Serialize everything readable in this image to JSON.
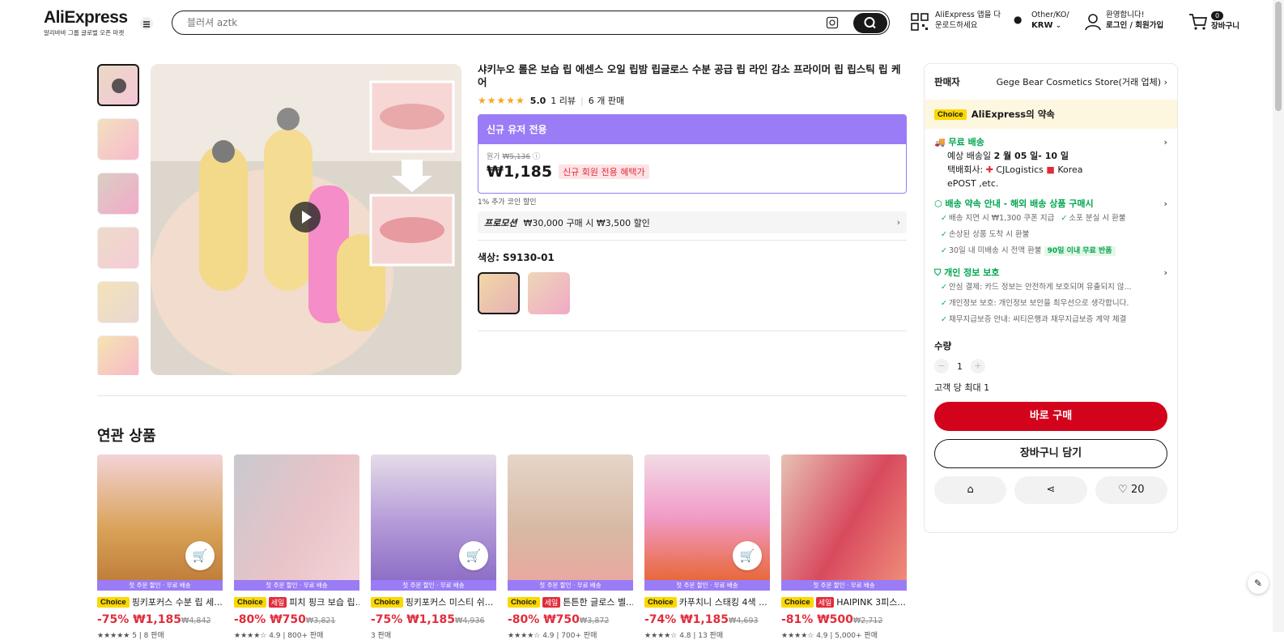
{
  "header": {
    "brand": "AliExpress",
    "brand_sub": "알리바바 그룹 글로벌 오픈 마켓",
    "search_placeholder": "블러셔 aztk",
    "app_line1": "AliExpress 앱을 다",
    "app_line2": "운로드하세요",
    "region_line1": "Other/KO/",
    "region_line2": "KRW",
    "account_line1": "환영합니다!",
    "account_line2": "로그인 / 회원가입",
    "cart_count": "0",
    "cart_label": "장바구니"
  },
  "product": {
    "title": "샤키누오 롤온 보습 립 에센스 오일 립밤 립글로스 수분 공급 립 라인 감소 프라이머 립 립스틱 립 케어",
    "rating": "5.0",
    "reviews": "1 리뷰",
    "sold": "6 개 판매",
    "new_user_label": "신규 유저 전용",
    "orig_label": "원가",
    "orig_price": "₩5,136",
    "price": "₩1,185",
    "price_badge": "신규 회원 전용 혜택가",
    "coin_note": "1% 추가 코인 할인",
    "promo_tag": "프로모션",
    "promo_text": "₩30,000 구매 시 ₩3,500 할인",
    "color_label": "색상: S9130-01"
  },
  "panel": {
    "seller_label": "판매자",
    "seller_name": "Gege Bear Cosmetics Store(거래 업체)",
    "choice_badge": "Choice",
    "promise": "AliExpress의 약속",
    "free_ship": "무료 배송",
    "eta_label": "예상 배송일",
    "eta": "2 월 05 일- 10 일",
    "carrier_label": "택배회사:",
    "carrier1": "CJLogistics",
    "carrier2": "Korea",
    "carrier3": "ePOST ,etc.",
    "guarantee_title": "배송 약속 안내 - 해외 배송 상품 구매시",
    "g1": "배송 지연 시 ₩1,300 쿠폰 지급",
    "g2": "소포 분실 시 환불",
    "g3": "손상된 상품 도착 시 환불",
    "g4": "30일 내 미배송 시 전액 환불",
    "g4_tag": "90일 이내 무료 반품",
    "privacy_title": "개인 정보 보호",
    "p1": "안심 결제: 카드 정보는 안전하게 보호되며 유출되지 않...",
    "p2": "개인정보 보호: 개인정보 보안을 최우선으로 생각합니다.",
    "p3": "채무지급보증 안내: 씨티은행과 채무지급보증 계약 체결",
    "qty_label": "수량",
    "qty_minus": "−",
    "qty": "1",
    "qty_plus": "+",
    "max_qty": "고객 당 최대 1",
    "buy_now": "바로 구매",
    "add_cart": "장바구니 담기",
    "wish_count": "20"
  },
  "related": {
    "title": "연관 상품",
    "strip": "첫 주문 할인 · 무료 배송",
    "items": [
      {
        "choice": "Choice",
        "sale": "",
        "name": "핑키포커스 수분 립 세...",
        "discount": "-75%",
        "price": "₩1,185",
        "orig": "₩4,842",
        "meta": "★★★★★ 5 | 8 판매"
      },
      {
        "choice": "Choice",
        "sale": "세일",
        "name": "피치 핑크 보습 립...",
        "discount": "-80%",
        "price": "₩750",
        "orig": "₩3,821",
        "meta": "★★★★☆ 4.9 | 800+ 판매"
      },
      {
        "choice": "Choice",
        "sale": "",
        "name": "핑키포커스 미스티 쉬...",
        "discount": "-75%",
        "price": "₩1,185",
        "orig": "₩4,936",
        "meta": "3 판매"
      },
      {
        "choice": "Choice",
        "sale": "세일",
        "name": "튼튼한 글로스 벨...",
        "discount": "-80%",
        "price": "₩750",
        "orig": "₩3,872",
        "meta": "★★★★☆ 4.9 | 700+ 판매"
      },
      {
        "choice": "Choice",
        "sale": "",
        "name": "카푸치니 스태킹 4색 ...",
        "discount": "-74%",
        "price": "₩1,185",
        "orig": "₩4,693",
        "meta": "★★★★☆ 4.8 | 13 판매"
      },
      {
        "choice": "Choice",
        "sale": "세일",
        "name": "HAIPINK 3피스...",
        "discount": "-81%",
        "price": "₩500",
        "orig": "₩2,712",
        "meta": "★★★★☆ 4.9 | 5,000+ 판매"
      }
    ]
  }
}
